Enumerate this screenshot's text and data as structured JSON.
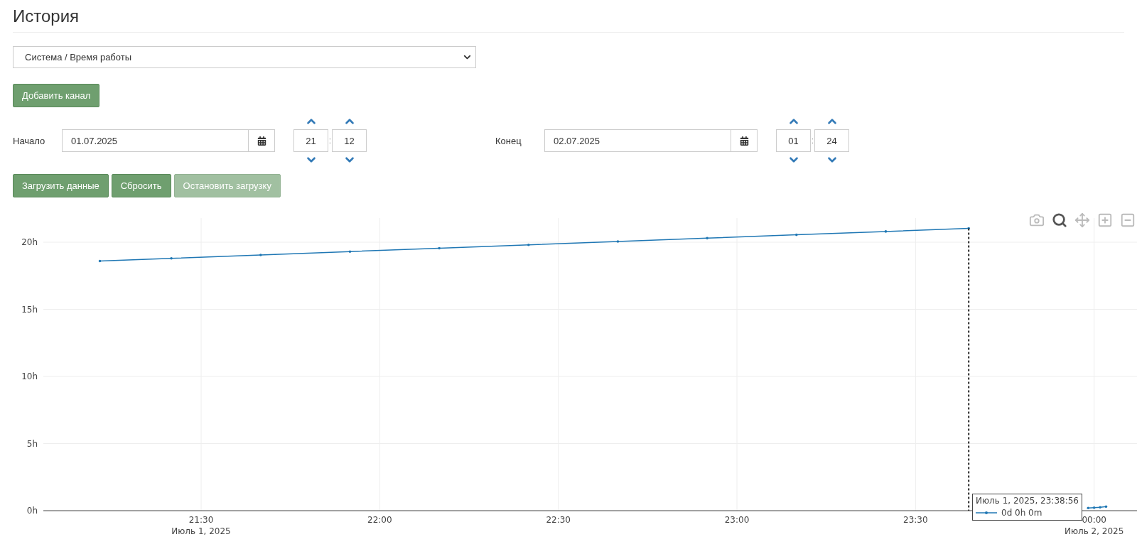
{
  "page": {
    "title": "История"
  },
  "channel_select": {
    "value": "Система / Время работы"
  },
  "add_channel_button": {
    "label": "Добавить канал"
  },
  "start": {
    "label": "Начало",
    "date": "01.07.2025",
    "hour": "21",
    "minute": "12",
    "separator": ":"
  },
  "end": {
    "label": "Конец",
    "date": "02.07.2025",
    "hour": "01",
    "minute": "24",
    "separator": ":"
  },
  "actions": [
    {
      "label": "Загрузить данные",
      "disabled": false
    },
    {
      "label": "Сбросить",
      "disabled": false
    },
    {
      "label": "Остановить загрузку",
      "disabled": true
    }
  ],
  "chart": {
    "modebar": [
      {
        "kind": "camera",
        "selected": false
      },
      {
        "kind": "zoom",
        "selected": true
      },
      {
        "kind": "pan",
        "selected": false
      },
      {
        "kind": "zoom_in",
        "selected": false
      },
      {
        "kind": "zoom_out",
        "selected": false
      }
    ],
    "date_labels": [
      "Июль 1, 2025",
      "Июль 2, 2025"
    ],
    "hover": {
      "title": "Июль 1, 2025, 23:38:56",
      "value": "0d 0h 0m"
    },
    "chart_data": {
      "type": "line",
      "grid": true,
      "x": [
        "2025-07-01 21:13:00",
        "2025-07-01 21:25:00",
        "2025-07-01 21:40:00",
        "2025-07-01 21:55:00",
        "2025-07-01 22:10:00",
        "2025-07-01 22:25:00",
        "2025-07-01 22:40:00",
        "2025-07-01 22:55:00",
        "2025-07-01 23:10:00",
        "2025-07-01 23:25:00",
        "2025-07-01 23:38:56",
        "2025-07-01 23:59:00",
        "2025-07-02 00:00:00",
        "2025-07-02 00:01:00",
        "2025-07-02 00:02:00"
      ],
      "series": [
        {
          "color": "#1f77b4",
          "values": [
            18.6,
            18.8,
            19.05,
            19.3,
            19.55,
            19.8,
            20.05,
            20.3,
            20.55,
            20.8,
            21.03,
            0.2,
            0.22,
            0.25,
            0.3
          ]
        }
      ],
      "xlim": [
        "2025-07-01 21:03:30",
        "2025-07-02 00:07:12"
      ],
      "ylim": [
        0,
        21.8
      ],
      "ref_lines": [
        {
          "axis": "x",
          "value": "2025-07-01 23:38:56",
          "color": "#222222"
        }
      ],
      "xticks": [
        {
          "value": "2025-07-01 21:30:00",
          "label": "21:30"
        },
        {
          "value": "2025-07-01 22:00:00",
          "label": "22:00"
        },
        {
          "value": "2025-07-01 22:30:00",
          "label": "22:30"
        },
        {
          "value": "2025-07-01 23:00:00",
          "label": "23:00"
        },
        {
          "value": "2025-07-01 23:30:00",
          "label": "23:30"
        },
        {
          "value": "2025-07-02 00:00:00",
          "label": "00:00"
        }
      ],
      "yticks": [
        {
          "value": 0,
          "label": "0h"
        },
        {
          "value": 5,
          "label": "5h"
        },
        {
          "value": 10,
          "label": "10h"
        },
        {
          "value": 15,
          "label": "15h"
        },
        {
          "value": 20,
          "label": "20h"
        }
      ]
    }
  }
}
